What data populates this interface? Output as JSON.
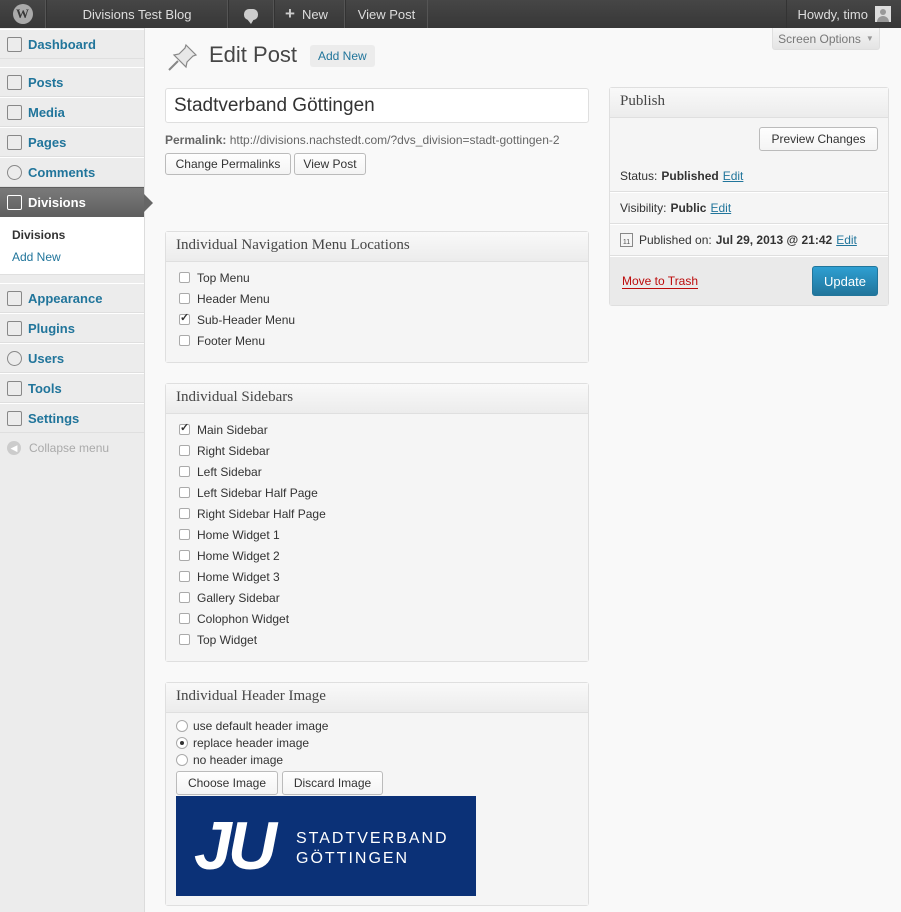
{
  "adminbar": {
    "logo_letter": "W",
    "site_name": "Divisions Test Blog",
    "new_label": "New",
    "view_post": "View Post",
    "howdy": "Howdy, timo"
  },
  "sidebar": {
    "items": [
      {
        "label": "Dashboard",
        "icon": "dashboard-icon"
      },
      {
        "label": "Posts",
        "icon": "pin-icon"
      },
      {
        "label": "Media",
        "icon": "media-icon"
      },
      {
        "label": "Pages",
        "icon": "pages-icon"
      },
      {
        "label": "Comments",
        "icon": "comments-icon"
      },
      {
        "label": "Divisions",
        "icon": "pin-icon"
      },
      {
        "label": "Appearance",
        "icon": "appearance-icon"
      },
      {
        "label": "Plugins",
        "icon": "plugin-icon"
      },
      {
        "label": "Users",
        "icon": "users-icon"
      },
      {
        "label": "Tools",
        "icon": "tools-icon"
      },
      {
        "label": "Settings",
        "icon": "settings-icon"
      }
    ],
    "submenu": {
      "current": "Divisions",
      "add_new": "Add New"
    },
    "collapse": "Collapse menu"
  },
  "screen_options": "Screen Options",
  "screen_options_arrow": "▼",
  "heading": {
    "title": "Edit Post",
    "add_new": "Add New"
  },
  "post": {
    "title": "Stadtverband Göttingen",
    "permalink_label": "Permalink:",
    "permalink_url": "http://divisions.nachstedt.com/?dvs_division=stadt-gottingen-2",
    "change_permalinks": "Change Permalinks",
    "view_post": "View Post"
  },
  "nav_box": {
    "title": "Individual Navigation Menu Locations",
    "items": [
      {
        "label": "Top Menu",
        "checked": false
      },
      {
        "label": "Header Menu",
        "checked": false
      },
      {
        "label": "Sub-Header Menu",
        "checked": true
      },
      {
        "label": "Footer Menu",
        "checked": false
      }
    ]
  },
  "sidebars_box": {
    "title": "Individual Sidebars",
    "items": [
      {
        "label": "Main Sidebar",
        "checked": true
      },
      {
        "label": "Right Sidebar",
        "checked": false
      },
      {
        "label": "Left Sidebar",
        "checked": false
      },
      {
        "label": "Left Sidebar Half Page",
        "checked": false
      },
      {
        "label": "Right Sidebar Half Page",
        "checked": false
      },
      {
        "label": "Home Widget 1",
        "checked": false
      },
      {
        "label": "Home Widget 2",
        "checked": false
      },
      {
        "label": "Home Widget 3",
        "checked": false
      },
      {
        "label": "Gallery Sidebar",
        "checked": false
      },
      {
        "label": "Colophon Widget",
        "checked": false
      },
      {
        "label": "Top Widget",
        "checked": false
      }
    ]
  },
  "header_box": {
    "title": "Individual Header Image",
    "options": [
      {
        "label": "use default header image",
        "selected": false
      },
      {
        "label": "replace header image",
        "selected": true
      },
      {
        "label": "no header image",
        "selected": false
      }
    ],
    "choose_image": "Choose Image",
    "discard_image": "Discard Image",
    "image": {
      "mark": "JU",
      "line1": "STADTVERBAND",
      "line2": "GÖTTINGEN",
      "bg_color": "#0b3177"
    }
  },
  "publish": {
    "title": "Publish",
    "preview": "Preview Changes",
    "status_label": "Status:",
    "status_value": "Published",
    "visibility_label": "Visibility:",
    "visibility_value": "Public",
    "published_label": "Published on:",
    "published_value": "Jul 29, 2013 @ 21:42",
    "calendar_day": "11",
    "edit": "Edit",
    "trash": "Move to Trash",
    "update": "Update"
  },
  "colors": {
    "link": "#21759b",
    "primary": "#21759b",
    "trash": "#bc0b0b",
    "adminbar": "#464646"
  }
}
